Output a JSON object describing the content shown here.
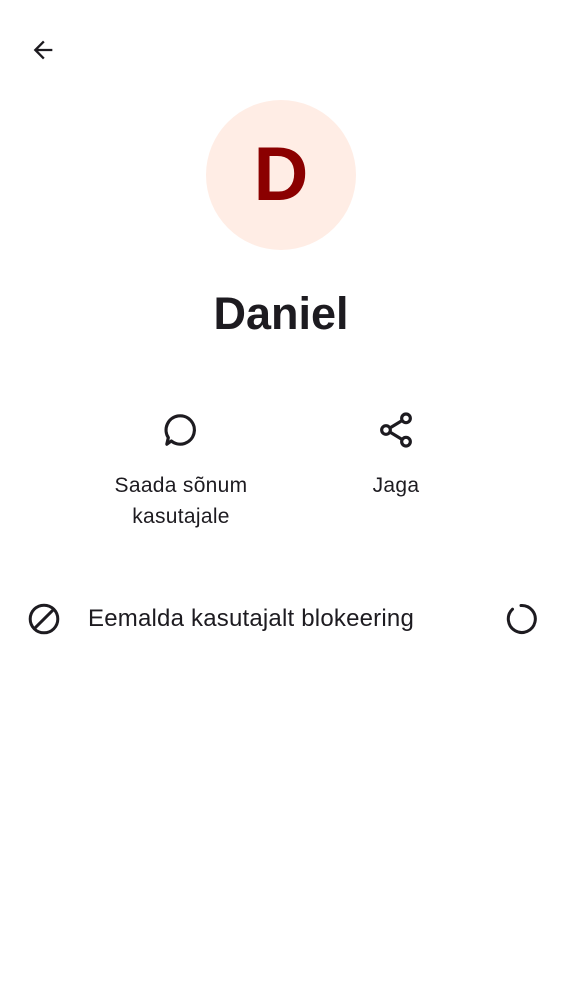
{
  "contact": {
    "initial": "D",
    "name": "Daniel"
  },
  "actions": {
    "message_label": "Saada sõnum kasutajale",
    "share_label": "Jaga"
  },
  "block": {
    "label": "Eemalda kasutajalt blokeering",
    "loading": true
  },
  "icons": {
    "back": "arrow-back-icon",
    "message": "chat-bubble-icon",
    "share": "share-icon",
    "block": "block-icon",
    "spinner": "progress-spinner-icon"
  },
  "colors": {
    "avatar_background": "#ffede5",
    "avatar_letter": "#8b0000",
    "text": "#1d1b20",
    "background": "#ffffff"
  }
}
